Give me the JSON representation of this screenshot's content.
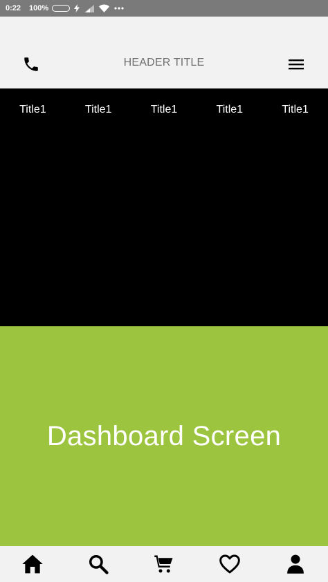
{
  "status_bar": {
    "time": "0:22",
    "battery_pct": "100%",
    "battery_level": 1.0,
    "battery_color": "#5cc22b",
    "icons": [
      "charging-bolt-icon",
      "signal-icon",
      "wifi-icon",
      "more-dots-icon"
    ]
  },
  "header": {
    "title": "HEADER TITLE",
    "left_icon": "phone-icon",
    "right_icon": "menu-icon"
  },
  "tabs": {
    "labels": [
      "Title1",
      "Title1",
      "Title1",
      "Title1",
      "Title1"
    ]
  },
  "main": {
    "title": "Dashboard Screen",
    "background": "#9cc43e"
  },
  "bottom_nav": {
    "items": [
      "home-icon",
      "search-icon",
      "cart-icon",
      "heart-icon",
      "profile-icon"
    ]
  }
}
